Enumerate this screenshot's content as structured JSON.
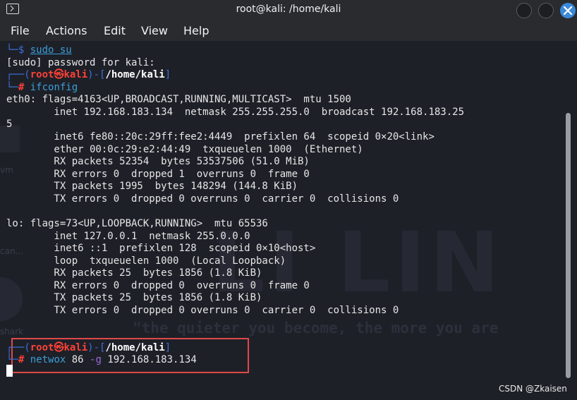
{
  "window": {
    "title": "root@kali: /home/kali"
  },
  "menu": [
    "File",
    "Actions",
    "Edit",
    "View",
    "Help"
  ],
  "watermark": {
    "logo": "LI LIN",
    "motto": "\"the quieter you become, the more you are"
  },
  "desktop_labels": [
    "vm",
    "can...",
    "shark"
  ],
  "terminal": {
    "prompt": {
      "user": "root",
      "at": "㉿",
      "host": "kali",
      "path": "/home/kali",
      "hash": "#",
      "dollar": "$"
    },
    "lines": {
      "l0_cmd": "sudo su",
      "l1": "[sudo] password for kali:",
      "l3_cmd": "ifconfig",
      "l4": "eth0: flags=4163<UP,BROADCAST,RUNNING,MULTICAST>  mtu 1500",
      "l5": "        inet 192.168.183.134  netmask 255.255.255.0  broadcast 192.168.183.25",
      "l6": "5",
      "l7": "        inet6 fe80::20c:29ff:fee2:4449  prefixlen 64  scopeid 0×20<link>",
      "l8": "        ether 00:0c:29:e2:44:49  txqueuelen 1000  (Ethernet)",
      "l9": "        RX packets 52354  bytes 53537506 (51.0 MiB)",
      "l10": "        RX errors 0  dropped 1  overruns 0  frame 0",
      "l11": "        TX packets 1995  bytes 148294 (144.8 KiB)",
      "l12": "        TX errors 0  dropped 0 overruns 0  carrier 0  collisions 0",
      "l13": "",
      "l14": "lo: flags=73<UP,LOOPBACK,RUNNING>  mtu 65536",
      "l15": "        inet 127.0.0.1  netmask 255.0.0.0",
      "l16": "        inet6 ::1  prefixlen 128  scopeid 0×10<host>",
      "l17": "        loop  txqueuelen 1000  (Local Loopback)",
      "l18": "        RX packets 25  bytes 1856 (1.8 KiB)",
      "l19": "        RX errors 0  dropped 0  overruns 0  frame 0",
      "l20": "        TX packets 25  bytes 1856 (1.8 KiB)",
      "l21": "        TX errors 0  dropped 0 overruns 0  carrier 0  collisions 0",
      "l24_cmd": "netwox",
      "l24_num": " 86 ",
      "l24_flag": "-g",
      "l24_ip": " 192.168.183.134"
    }
  },
  "footer": {
    "credit": "CSDN @Zkaisen"
  },
  "colors": {
    "prompt_frame": "#3d6fd9",
    "prompt_user": "#ff4136",
    "command": "#3a9fd8",
    "flag": "#9b6bd9",
    "highlight": "#e04848",
    "close_button": "#3b89d8"
  }
}
